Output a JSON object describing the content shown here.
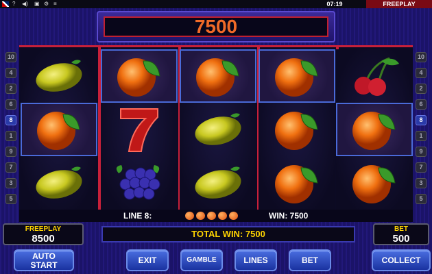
{
  "topbar": {
    "icons": [
      "uk-flag-icon",
      "help-icon",
      "sound-icon",
      "fullscreen-icon",
      "settings-icon",
      "menu-icon"
    ],
    "time": "07:19",
    "mode": "FREEPLAY"
  },
  "win_display": "7500",
  "line_numbers_left": [
    "10",
    "4",
    "2",
    "6",
    "8",
    "1",
    "9",
    "7",
    "3",
    "5"
  ],
  "line_numbers_right": [
    "10",
    "4",
    "2",
    "6",
    "8",
    "1",
    "9",
    "7",
    "3",
    "5"
  ],
  "active_line": "8",
  "reels": [
    [
      "lemon",
      "orange",
      "lemon"
    ],
    [
      "orange",
      "seven",
      "grapes"
    ],
    [
      "orange",
      "lemon",
      "lemon"
    ],
    [
      "orange",
      "orange",
      "orange"
    ],
    [
      "cherries",
      "orange",
      "orange"
    ]
  ],
  "info": {
    "line_label": "LINE 8:",
    "win_label": "WIN: 7500"
  },
  "balance": {
    "label": "FREEPLAY",
    "value": "8500"
  },
  "total_win": "TOTAL WIN: 7500",
  "bet": {
    "label": "BET",
    "value": "500"
  },
  "buttons": {
    "auto_start_1": "AUTO",
    "auto_start_2": "START",
    "exit": "EXIT",
    "gamble": "GAMBLE",
    "lines": "LINES",
    "bet": "BET",
    "collect": "COLLECT"
  },
  "colors": {
    "accent_red": "#c8203a",
    "win_orange": "#f06a28",
    "label_yellow": "#ffd400",
    "button_blue": "#2a4ac0"
  }
}
